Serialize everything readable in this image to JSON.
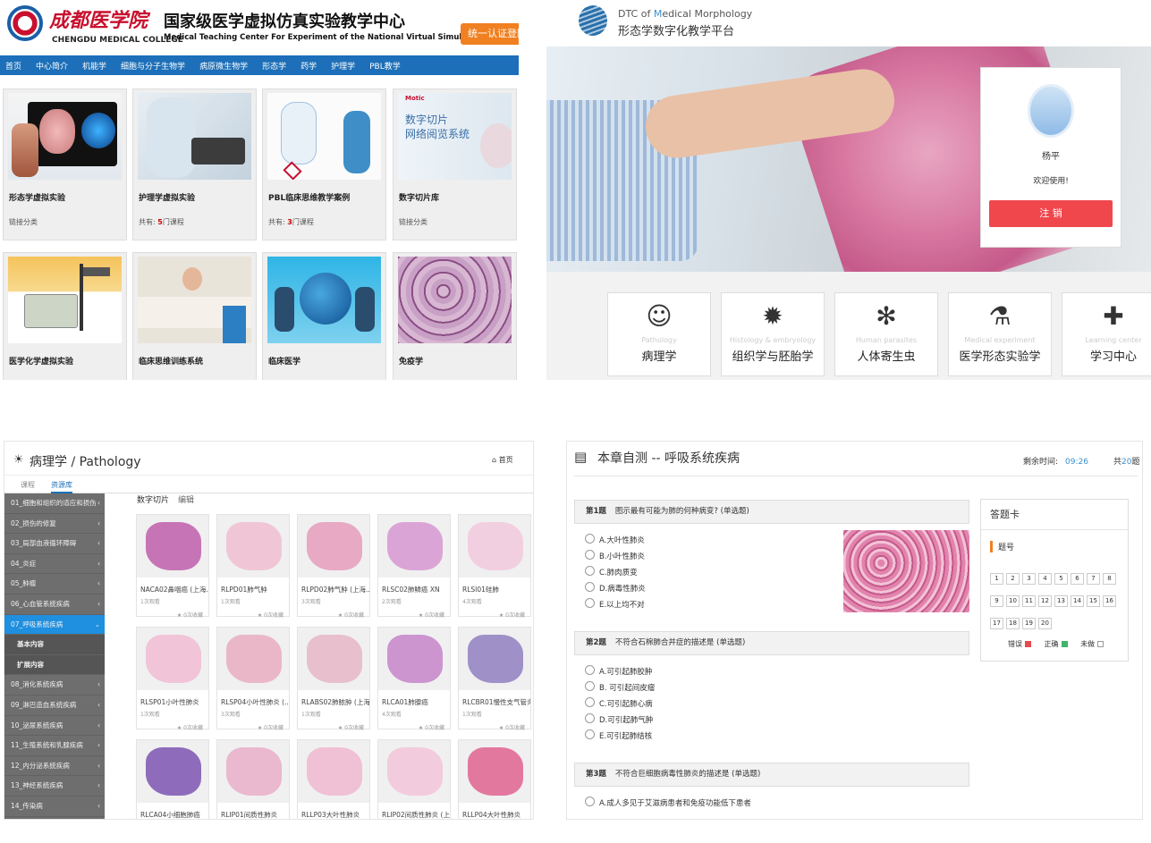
{
  "p1": {
    "school_cn": "成都医学院",
    "school_en": "CHENGDU MEDICAL COLLEGE",
    "title_cn": "国家级医学虚拟仿真实验教学中心",
    "title_en": "Medical Teaching Center For Experiment of the National Virtual Simulation",
    "login": "统一认证登陆",
    "nav": [
      "首页",
      "中心简介",
      "机能学",
      "细胞与分子生物学",
      "病原微生物学",
      "形态学",
      "药学",
      "护理学",
      "PBL教学"
    ],
    "cards": [
      {
        "title": "形态学虚拟实验",
        "sub": "链接分类"
      },
      {
        "title": "护理学虚拟实验",
        "pre": "共有: ",
        "num": "5",
        "post": "门课程"
      },
      {
        "title": "PBL临床思维教学案例",
        "pre": "共有: ",
        "num": "3",
        "post": "门课程"
      },
      {
        "title": "数字切片库",
        "sub": "链接分类"
      },
      {
        "title": "医学化学虚拟实验"
      },
      {
        "title": "临床思维训练系统"
      },
      {
        "title": "临床医学"
      },
      {
        "title": "免疫学"
      }
    ],
    "thumb3_text": "数字切片\n网络阅览系统"
  },
  "p2": {
    "brand_en_a": "DTC of ",
    "brand_en_m": "M",
    "brand_en_b": "edical Morphology",
    "brand_cn": "形态学数字化教学平台",
    "user": "杨平",
    "welcome": "欢迎使用!",
    "logout": "注 销",
    "modules": [
      {
        "en": "Pathology",
        "cn": "病理学",
        "icon": "head-icon"
      },
      {
        "en": "Histology & embryology",
        "cn": "组织学与胚胎学",
        "icon": "virus-icon"
      },
      {
        "en": "Human parasites",
        "cn": "人体寄生虫",
        "icon": "tick-icon"
      },
      {
        "en": "Medical experiment",
        "cn": "医学形态实验学",
        "icon": "flask-icon"
      },
      {
        "en": "Learning center",
        "cn": "学习中心",
        "icon": "book-icon"
      }
    ]
  },
  "p3": {
    "title": "病理学 / Pathology",
    "home": "首页",
    "tabs": [
      "课程",
      "资源库"
    ],
    "section": "数字切片",
    "edit": "编辑",
    "sidebar": [
      "01_细胞和组织的适应和损伤",
      "02_损伤的修复",
      "03_局部血液循环障碍",
      "04_炎症",
      "05_肿瘤",
      "06_心血管系统疾病",
      "07_呼吸系统疾病",
      "基本内容",
      "扩展内容",
      "08_消化系统疾病",
      "09_淋巴造血系统疾病",
      "10_泌尿系统疾病",
      "11_生殖系统和乳腺疾病",
      "12_内分泌系统疾病",
      "13_神经系统疾病",
      "14_传染病"
    ],
    "slides": [
      {
        "name": "NACA02鼻咽癌 (上海...",
        "views": "1次观看",
        "color": "#c774b6"
      },
      {
        "name": "RLPD01肺气肿",
        "views": "1次观看",
        "color": "#f0c6d6"
      },
      {
        "name": "RLPD02肺气肿 (上海...",
        "views": "3次观看",
        "color": "#e7a9c3"
      },
      {
        "name": "RLSC02肺鳞癌 XN",
        "views": "2次观看",
        "color": "#dba4d6"
      },
      {
        "name": "RLSI01硅肺",
        "views": "4次观看",
        "color": "#f2cfe0"
      },
      {
        "name": "RLSP01小叶性肺炎",
        "views": "1次观看",
        "color": "#f1c4d8"
      },
      {
        "name": "RLSP04小叶性肺炎 (...",
        "views": "3次观看",
        "color": "#eab7c9"
      },
      {
        "name": "RLABS02肺脓肿 (上海...",
        "views": "1次观看",
        "color": "#e8bfcd"
      },
      {
        "name": "RLCA01肺腺癌",
        "views": "4次观看",
        "color": "#cc95d0"
      },
      {
        "name": "RLCBR01慢性支气管炎...",
        "views": "1次观看",
        "color": "#9f90c8"
      },
      {
        "name": "RLCA04小细胞肺癌",
        "views": "1次观看",
        "color": "#8e6cbb"
      },
      {
        "name": "RLIP01间质性肺炎",
        "views": "1次观看",
        "color": "#eab8cf"
      },
      {
        "name": "RLLP03大叶性肺炎",
        "views": "1次观看",
        "color": "#f0c0d5"
      },
      {
        "name": "RLIP02间质性肺炎 (上...",
        "views": "1次观看",
        "color": "#f2cbdc"
      },
      {
        "name": "RLLP04大叶性肺炎",
        "views": "1次观看",
        "color": "#e3789f"
      }
    ],
    "stars": "0次收藏"
  },
  "p4": {
    "title": "本章自测 -- 呼吸系统疾病",
    "timer_label": "剩余时间:",
    "timer": "09:26",
    "total_pre": "共",
    "total": "20",
    "total_post": "题",
    "questions": [
      {
        "no": "第1题",
        "text": "图示最有可能为肺的何种病变? (单选题)",
        "options": [
          "A.大叶性肺炎",
          "B.小叶性肺炎",
          "C.肺肉质变",
          "D.病毒性肺炎",
          "E.以上均不对"
        ]
      },
      {
        "no": "第2题",
        "text": "不符合石棉肺合并症的描述是 (单选题)",
        "options": [
          "A.可引起肺胶肿",
          "B. 可引起间皮瘤",
          "C.可引起肺心病",
          "D.可引起肺气肿",
          "E.可引起肺结核"
        ]
      },
      {
        "no": "第3题",
        "text": "不符合巨细胞病毒性肺炎的描述是 (单选题)",
        "options": [
          "A.成人多见于艾滋病患者和免疫功能低下患者"
        ]
      }
    ],
    "card_title": "答题卡",
    "card_label": "题号",
    "numbers": [
      "1",
      "2",
      "3",
      "4",
      "5",
      "6",
      "7",
      "8",
      "9",
      "10",
      "11",
      "12",
      "13",
      "14",
      "15",
      "16",
      "17",
      "18",
      "19",
      "20"
    ],
    "legend": [
      {
        "label": "错误",
        "color": "#e84a4a"
      },
      {
        "label": "正确",
        "color": "#3fb56a"
      },
      {
        "label": "未做",
        "color": "#ffffff"
      }
    ]
  }
}
